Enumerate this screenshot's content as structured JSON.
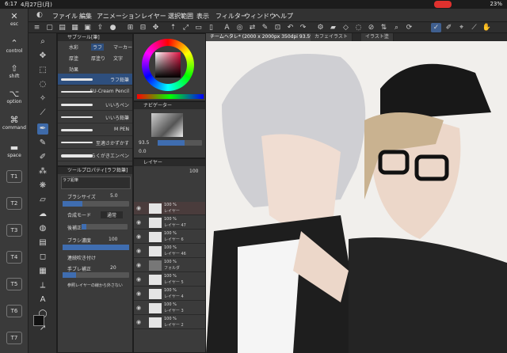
{
  "status": {
    "time": "6:17",
    "date": "4月27日(月)",
    "battery": "23%"
  },
  "menu": [
    "ファイル",
    "編集",
    "アニメーション",
    "レイヤー",
    "選択範囲",
    "表示",
    "フィルター",
    "ウィンドウ",
    "ヘルプ"
  ],
  "left_keys": [
    "esc",
    "control",
    "shift",
    "option",
    "command",
    "space",
    "T1",
    "T2",
    "T3",
    "T4",
    "T5",
    "T6",
    "T7"
  ],
  "subtool": {
    "title": "サブツール[筆]",
    "tabs": [
      "水彩",
      "ラフ",
      "マーカー"
    ],
    "tabs2": [
      "厚塗",
      "厚塗り",
      "文字"
    ],
    "group_label": "効果",
    "selected_label": "ラフ鉛筆",
    "brushes": [
      {
        "name": "SU-Cream Pencil"
      },
      {
        "name": "いいろペン"
      },
      {
        "name": "いいろ鉛筆"
      },
      {
        "name": "M PEN"
      },
      {
        "name": "至適さかずかす"
      },
      {
        "name": "らくがきエンペン"
      },
      {
        "name": "ぼかし"
      }
    ]
  },
  "navigator": {
    "title": "ナビゲーター",
    "zoom": "93.5",
    "angle": "0.0"
  },
  "toolprop": {
    "title": "ツールプロパティ[ラフ鉛筆]",
    "name": "ラフ鉛筆",
    "size_label": "ブラシサイズ",
    "size_value": "5.0",
    "size_fill": 0.3,
    "blend_label": "合成モード",
    "blend_value": "通常",
    "density_label": "ブラシ濃度",
    "density_value": "100",
    "density_fill": 1.0,
    "stabilize_label": "手ブレ補正",
    "stabilize_value": "20",
    "stabilize_fill": 0.2,
    "continuous_label": "連続吹き付け",
    "ref_label": "参照レイヤーの線から外さない",
    "smooth_label": "後補正"
  },
  "layers": {
    "title": "レイヤー",
    "opacity": "100",
    "rows": [
      {
        "pct": "100 %",
        "name": "レイヤー",
        "active": true
      },
      {
        "pct": "100 %",
        "name": "レイヤー 47"
      },
      {
        "pct": "100 %",
        "name": "レイヤー 6"
      },
      {
        "pct": "100 %",
        "name": "レイヤー 46"
      },
      {
        "pct": "100 %",
        "name": "フォルダ"
      },
      {
        "pct": "100 %",
        "name": "レイヤー 5"
      },
      {
        "pct": "100 %",
        "name": "レイヤー 4"
      },
      {
        "pct": "100 %",
        "name": "レイヤー 3"
      },
      {
        "pct": "100 %",
        "name": "レイヤー 2"
      }
    ]
  },
  "canvas_tabs": [
    "チームヘタレ* (2000 x 2000px 350dpi 93.5%)",
    "カフェイラスト",
    "イラスト塗"
  ],
  "colors": {
    "primary": "#111111",
    "secondary": "#ffffff",
    "accent": "#3e6aa8"
  }
}
